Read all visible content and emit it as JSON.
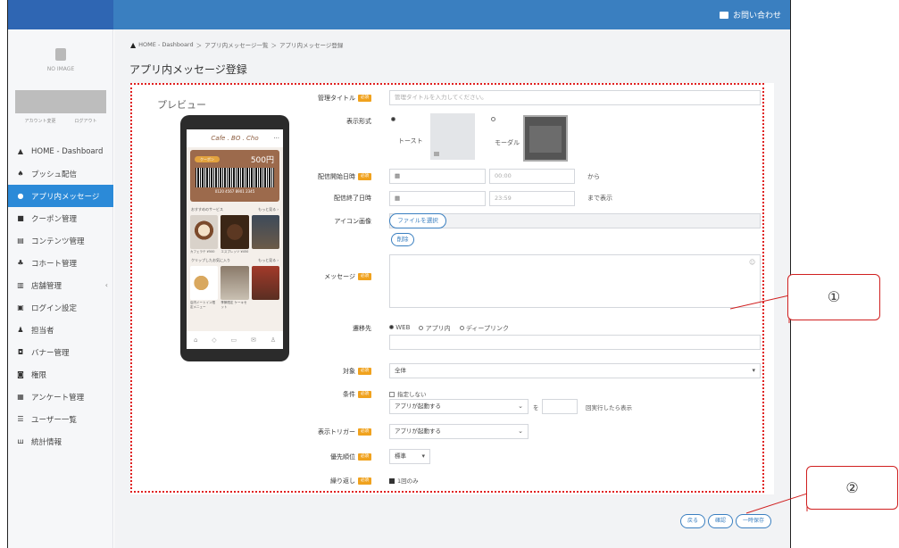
{
  "topbar": {
    "brand": "",
    "contact": "お問い合わせ"
  },
  "sidebar": {
    "logo_text": "NO IMAGE",
    "account_links": [
      "アカウント変更",
      "ログアウト"
    ],
    "items": [
      {
        "label": "HOME - Dashboard",
        "icon": "home-icon",
        "glyph": "▲"
      },
      {
        "label": "プッシュ配信",
        "icon": "bell-icon",
        "glyph": "♠"
      },
      {
        "label": "アプリ内メッセージ",
        "icon": "chat-icon",
        "glyph": "●",
        "active": true
      },
      {
        "label": "クーポン管理",
        "icon": "coupon-icon",
        "glyph": "■"
      },
      {
        "label": "コンテンツ管理",
        "icon": "document-icon",
        "glyph": "▤"
      },
      {
        "label": "コホート管理",
        "icon": "sitemap-icon",
        "glyph": "♣"
      },
      {
        "label": "店舗管理",
        "icon": "store-icon",
        "glyph": "▥",
        "caret": "‹"
      },
      {
        "label": "ログイン設定",
        "icon": "lock-icon",
        "glyph": "▣"
      },
      {
        "label": "担当者",
        "icon": "user-icon",
        "glyph": "♟"
      },
      {
        "label": "バナー管理",
        "icon": "banner-icon",
        "glyph": "◘"
      },
      {
        "label": "権限",
        "icon": "check-icon",
        "glyph": "◙"
      },
      {
        "label": "アンケート管理",
        "icon": "survey-icon",
        "glyph": "▦"
      },
      {
        "label": "ユーザー一覧",
        "icon": "list-icon",
        "glyph": "☰"
      },
      {
        "label": "統計情報",
        "icon": "chart-icon",
        "glyph": "ш"
      }
    ]
  },
  "breadcrumb": [
    "HOME - Dashboard",
    "アプリ内メッセージ一覧",
    "アプリ内メッセージ登録"
  ],
  "page_title": "アプリ内メッセージ登録",
  "preview": {
    "label": "プレビュー",
    "cafe_name": "Cafe . BO . Cho",
    "price": "500円",
    "coupon_tag": "クーポン",
    "barcode_number": "0120 4567 8901 2345",
    "section1": "おすすめのサービス",
    "section1_more": "もっと見る ›",
    "section2": "クリップしたお気に入り",
    "section2_more": "もっと見る ›",
    "captions1": [
      "カフェラテ ¥500",
      "エスプレッソ ¥450",
      ""
    ],
    "captions2": [
      "店内イートイン限定メニュー",
      "季節限定 ケーキセット",
      ""
    ]
  },
  "form": {
    "req_label": "必須",
    "admin_title_label": "管理タイトル",
    "admin_title_placeholder": "管理タイトルを入力してください。",
    "display_format_label": "表示形式",
    "toast_label": "トースト",
    "modal_label": "モーダル",
    "start_label": "配信開始日時",
    "start_time": "00:00",
    "start_suffix": "から",
    "end_label": "配信終了日時",
    "end_time": "23:59",
    "end_suffix": "まで表示",
    "icon_label": "アイコン画像",
    "file_button": "ファイルを選択",
    "delete_button": "削除",
    "message_label": "メッセージ",
    "link_label": "遷移先",
    "link_options": [
      "WEB",
      "アプリ内",
      "ディープリンク"
    ],
    "target_label": "対象",
    "target_value": "全体",
    "condition_label": "条件",
    "condition_check": "指定しない",
    "condition_select": "アプリが起動する",
    "condition_mid": "を",
    "condition_suffix": "回実行したら表示",
    "trigger_label": "表示トリガー",
    "trigger_value": "アプリが起動する",
    "priority_label": "優先順位",
    "priority_value": "標準",
    "repeat_label": "繰り返し",
    "repeat_check": "1回のみ"
  },
  "buttons": {
    "back": "戻る",
    "confirm": "確認",
    "draft": "一時保存"
  },
  "callouts": [
    "①",
    "②"
  ],
  "colors": {
    "topbar": "#3a7fc0",
    "active": "#2b8ad8",
    "required": "#f0a21e",
    "annotation": "#e02020"
  }
}
